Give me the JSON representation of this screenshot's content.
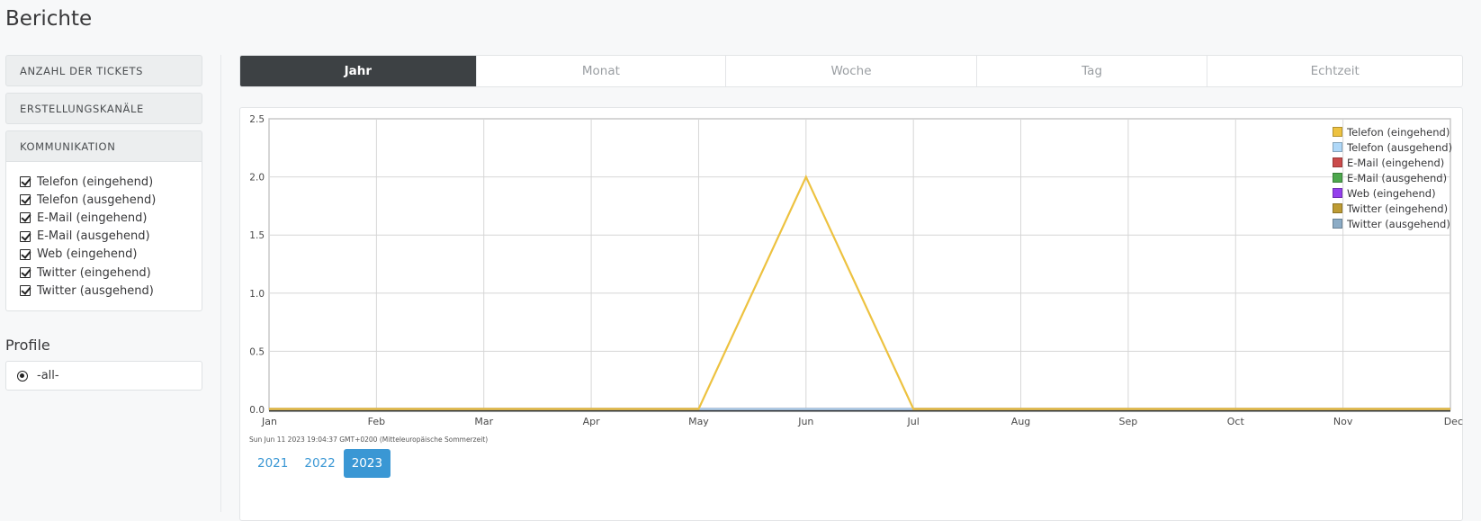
{
  "page": {
    "title": "Berichte"
  },
  "sidebar": {
    "sections": [
      {
        "label": "ANZAHL DER TICKETS"
      },
      {
        "label": "ERSTELLUNGSKANÄLE"
      },
      {
        "label": "KOMMUNIKATION"
      }
    ],
    "checkboxes": [
      {
        "label": "Telefon (eingehend)",
        "checked": true
      },
      {
        "label": "Telefon (ausgehend)",
        "checked": true
      },
      {
        "label": "E-Mail (eingehend)",
        "checked": true
      },
      {
        "label": "E-Mail (ausgehend)",
        "checked": true
      },
      {
        "label": "Web (eingehend)",
        "checked": true
      },
      {
        "label": "Twitter (eingehend)",
        "checked": true
      },
      {
        "label": "Twitter (ausgehend)",
        "checked": true
      }
    ],
    "profile": {
      "title": "Profile",
      "option": "-all-"
    }
  },
  "tabs": [
    {
      "label": "Jahr",
      "active": true
    },
    {
      "label": "Monat"
    },
    {
      "label": "Woche"
    },
    {
      "label": "Tag"
    },
    {
      "label": "Echtzeit"
    }
  ],
  "timestamp": "Sun Jun 11 2023 19:04:37 GMT+0200 (Mitteleuropäische Sommerzeit)",
  "years": [
    {
      "label": "2021"
    },
    {
      "label": "2022"
    },
    {
      "label": "2023",
      "active": true
    }
  ],
  "chart_data": {
    "type": "line",
    "x": [
      "Jan",
      "Feb",
      "Mar",
      "Apr",
      "May",
      "Jun",
      "Jul",
      "Aug",
      "Sep",
      "Oct",
      "Nov",
      "Dec"
    ],
    "ylim": [
      0,
      2.5
    ],
    "yticks": [
      "0.0",
      "0.5",
      "1.0",
      "1.5",
      "2.0",
      "2.5"
    ],
    "grid": true,
    "legend_position": "top-right",
    "series": [
      {
        "name": "Telefon (eingehend)",
        "color": "#edc240",
        "values": [
          0,
          0,
          0,
          0,
          0,
          2,
          0,
          0,
          0,
          0,
          0,
          0
        ]
      },
      {
        "name": "Telefon (ausgehend)",
        "color": "#afd8f8",
        "values": [
          0,
          0,
          0,
          0,
          0,
          0,
          0,
          0,
          0,
          0,
          0,
          0
        ]
      },
      {
        "name": "E-Mail (eingehend)",
        "color": "#cb4b4b",
        "values": [
          0,
          0,
          0,
          0,
          0,
          0,
          0,
          0,
          0,
          0,
          0,
          0
        ]
      },
      {
        "name": "E-Mail (ausgehend)",
        "color": "#4da74d",
        "values": [
          0,
          0,
          0,
          0,
          0,
          0,
          0,
          0,
          0,
          0,
          0,
          0
        ]
      },
      {
        "name": "Web (eingehend)",
        "color": "#9440ed",
        "values": [
          0,
          0,
          0,
          0,
          0,
          0,
          0,
          0,
          0,
          0,
          0,
          0
        ]
      },
      {
        "name": "Twitter (eingehend)",
        "color": "#bd9b33",
        "values": [
          0,
          0,
          0,
          0,
          0,
          0,
          0,
          0,
          0,
          0,
          0,
          0
        ]
      },
      {
        "name": "Twitter (ausgehend)",
        "color": "#8cacc6",
        "values": [
          0,
          0,
          0,
          0,
          0,
          0,
          0,
          0,
          0,
          0,
          0,
          0
        ]
      }
    ]
  }
}
